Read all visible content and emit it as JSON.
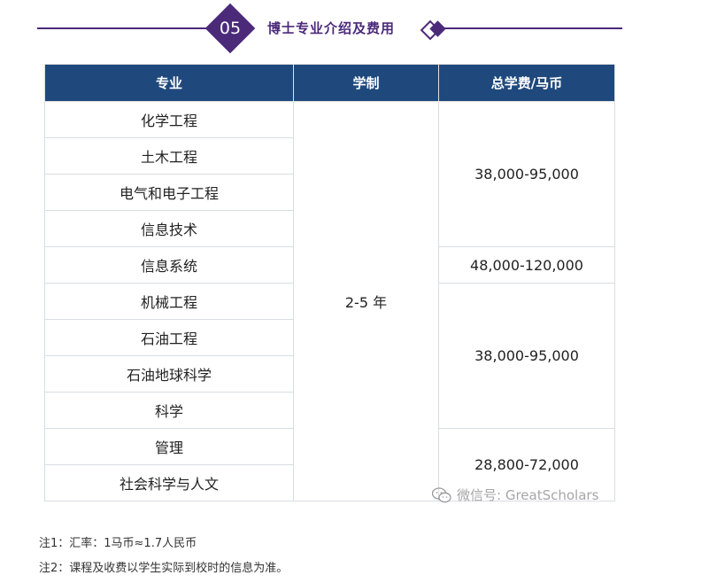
{
  "header": {
    "section_number": "05",
    "title": "博士专业介绍及费用"
  },
  "table": {
    "columns": [
      "专业",
      "学制",
      "总学费/马币"
    ],
    "duration": "2-5 年",
    "majors": [
      "化学工程",
      "土木工程",
      "电气和电子工程",
      "信息技术",
      "信息系统",
      "机械工程",
      "石油工程",
      "石油地球科学",
      "科学",
      "管理",
      "社会科学与人文"
    ],
    "fees": [
      "38,000-95,000",
      "48,000-120,000",
      "38,000-95,000",
      "28,800-72,000"
    ]
  },
  "notes": {
    "note1": "注1：汇率：1马币≈1.7人民币",
    "note2": "注2：课程及收费以学生实际到校时的信息为准。"
  },
  "watermark": "微信号: GreatScholars",
  "colors": {
    "accent_purple": "#4b2a7a",
    "header_blue": "#1f497d"
  }
}
